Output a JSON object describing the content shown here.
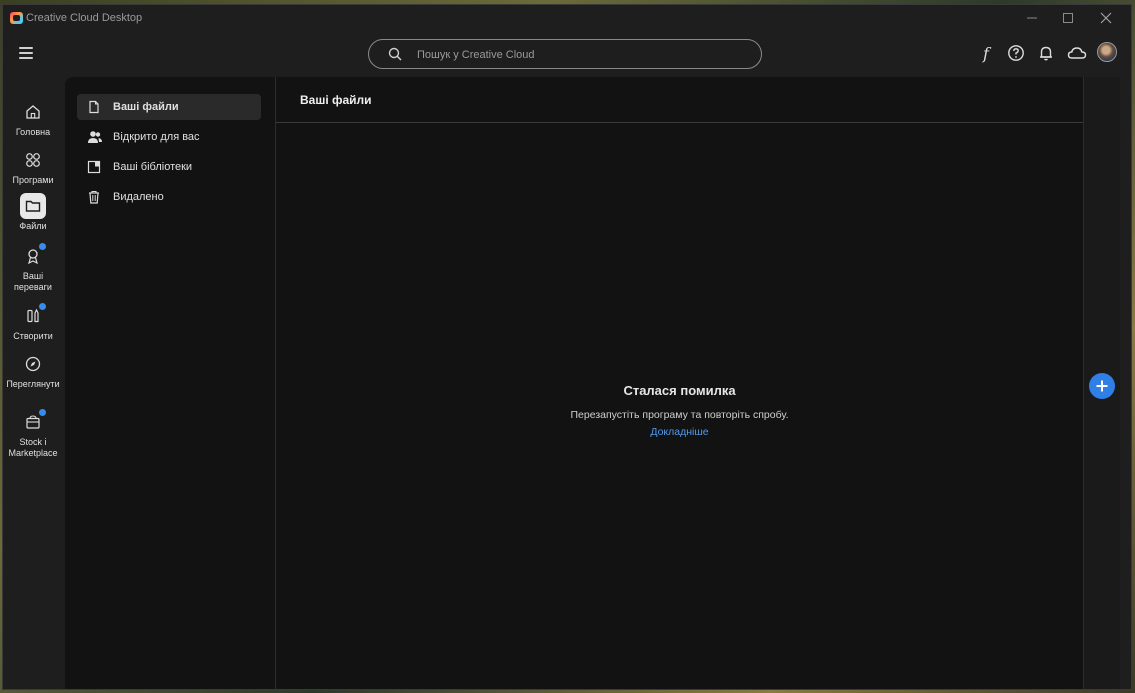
{
  "window": {
    "title": "Creative Cloud Desktop"
  },
  "header": {
    "search_placeholder": "Пошук у Creative Cloud",
    "font_icon_glyph": "f"
  },
  "rail": {
    "items": [
      {
        "label": "Головна",
        "icon": "home-icon"
      },
      {
        "label": "Програми",
        "icon": "apps-icon"
      },
      {
        "label": "Файли",
        "icon": "folder-icon",
        "active": true
      },
      {
        "label": "Ваші переваги",
        "icon": "badge-icon",
        "dot": true
      },
      {
        "label": "Створити",
        "icon": "create-icon",
        "dot": true
      },
      {
        "label": "Переглянути",
        "icon": "compass-icon"
      },
      {
        "label": "Stock і Marketplace",
        "icon": "stock-icon",
        "dot": true
      }
    ]
  },
  "subnav": {
    "items": [
      {
        "label": "Ваші файли",
        "icon": "file-icon",
        "active": true
      },
      {
        "label": "Відкрито для вас",
        "icon": "shared-users-icon"
      },
      {
        "label": "Ваші бібліотеки",
        "icon": "library-icon"
      },
      {
        "label": "Видалено",
        "icon": "trash-icon"
      }
    ]
  },
  "content": {
    "title": "Ваші файли",
    "error_title": "Сталася помилка",
    "error_message": "Перезапустіть програму та повторіть спробу.",
    "error_link": "Докладніше"
  },
  "colors": {
    "accent": "#2f7fe6",
    "link": "#4f9bf0",
    "background": "#121212"
  }
}
